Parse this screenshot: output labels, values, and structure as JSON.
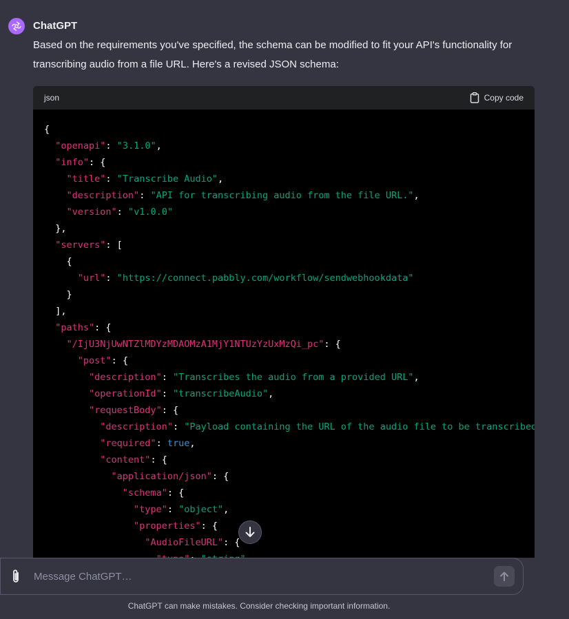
{
  "author": "ChatGPT",
  "message": "Based on the requirements you've specified, the schema can be modified to fit your API's functionality for transcribing audio from a file URL. Here's a revised JSON schema:",
  "code_block": {
    "language": "json",
    "copy_label": "Copy code",
    "lines": [
      [
        [
          "p",
          "{"
        ]
      ],
      [
        [
          "p",
          "  "
        ],
        [
          "k",
          "\"openapi\""
        ],
        [
          "p",
          ": "
        ],
        [
          "s",
          "\"3.1.0\""
        ],
        [
          "p",
          ","
        ]
      ],
      [
        [
          "p",
          "  "
        ],
        [
          "k",
          "\"info\""
        ],
        [
          "p",
          ": {"
        ]
      ],
      [
        [
          "p",
          "    "
        ],
        [
          "k",
          "\"title\""
        ],
        [
          "p",
          ": "
        ],
        [
          "s",
          "\"Transcribe Audio\""
        ],
        [
          "p",
          ","
        ]
      ],
      [
        [
          "p",
          "    "
        ],
        [
          "k",
          "\"description\""
        ],
        [
          "p",
          ": "
        ],
        [
          "s",
          "\"API for transcribing audio from the file URL.\""
        ],
        [
          "p",
          ","
        ]
      ],
      [
        [
          "p",
          "    "
        ],
        [
          "k",
          "\"version\""
        ],
        [
          "p",
          ": "
        ],
        [
          "s",
          "\"v1.0.0\""
        ]
      ],
      [
        [
          "p",
          "  },"
        ]
      ],
      [
        [
          "p",
          "  "
        ],
        [
          "k",
          "\"servers\""
        ],
        [
          "p",
          ": ["
        ]
      ],
      [
        [
          "p",
          "    {"
        ]
      ],
      [
        [
          "p",
          "      "
        ],
        [
          "k",
          "\"url\""
        ],
        [
          "p",
          ": "
        ],
        [
          "s",
          "\"https://connect.pabbly.com/workflow/sendwebhookdata\""
        ]
      ],
      [
        [
          "p",
          "    }"
        ]
      ],
      [
        [
          "p",
          "  ],"
        ]
      ],
      [
        [
          "p",
          "  "
        ],
        [
          "k",
          "\"paths\""
        ],
        [
          "p",
          ": {"
        ]
      ],
      [
        [
          "p",
          "    "
        ],
        [
          "k",
          "\"/IjU3NjUwNTZlMDYzMDAOMzA1MjY1NTUzYzUxMzQi_pc\""
        ],
        [
          "p",
          ": {"
        ]
      ],
      [
        [
          "p",
          "      "
        ],
        [
          "k",
          "\"post\""
        ],
        [
          "p",
          ": {"
        ]
      ],
      [
        [
          "p",
          "        "
        ],
        [
          "k",
          "\"description\""
        ],
        [
          "p",
          ": "
        ],
        [
          "s",
          "\"Transcribes the audio from a provided URL\""
        ],
        [
          "p",
          ","
        ]
      ],
      [
        [
          "p",
          "        "
        ],
        [
          "k",
          "\"operationId\""
        ],
        [
          "p",
          ": "
        ],
        [
          "s",
          "\"transcribeAudio\""
        ],
        [
          "p",
          ","
        ]
      ],
      [
        [
          "p",
          "        "
        ],
        [
          "k",
          "\"requestBody\""
        ],
        [
          "p",
          ": {"
        ]
      ],
      [
        [
          "p",
          "          "
        ],
        [
          "k",
          "\"description\""
        ],
        [
          "p",
          ": "
        ],
        [
          "s",
          "\"Payload containing the URL of the audio file to be transcribed\""
        ],
        [
          "p",
          ","
        ]
      ],
      [
        [
          "p",
          "          "
        ],
        [
          "k",
          "\"required\""
        ],
        [
          "p",
          ": "
        ],
        [
          "b",
          "true"
        ],
        [
          "p",
          ","
        ]
      ],
      [
        [
          "p",
          "          "
        ],
        [
          "k",
          "\"content\""
        ],
        [
          "p",
          ": {"
        ]
      ],
      [
        [
          "p",
          "            "
        ],
        [
          "k",
          "\"application/json\""
        ],
        [
          "p",
          ": {"
        ]
      ],
      [
        [
          "p",
          "              "
        ],
        [
          "k",
          "\"schema\""
        ],
        [
          "p",
          ": {"
        ]
      ],
      [
        [
          "p",
          "                "
        ],
        [
          "k",
          "\"type\""
        ],
        [
          "p",
          ": "
        ],
        [
          "s",
          "\"object\""
        ],
        [
          "p",
          ","
        ]
      ],
      [
        [
          "p",
          "                "
        ],
        [
          "k",
          "\"properties\""
        ],
        [
          "p",
          ": {"
        ]
      ],
      [
        [
          "p",
          "                  "
        ],
        [
          "k",
          "\"AudioFileURL\""
        ],
        [
          "p",
          ": {"
        ]
      ],
      [
        [
          "p",
          "                    "
        ],
        [
          "k",
          "\"type\""
        ],
        [
          "p",
          ": "
        ],
        [
          "s",
          "\"string\""
        ],
        [
          "p",
          ","
        ]
      ]
    ]
  },
  "composer": {
    "placeholder": "Message ChatGPT…"
  },
  "disclaimer": "ChatGPT can make mistakes. Consider checking important information.",
  "colors": {
    "background": "#343541",
    "code_bg": "#000000",
    "code_header": "#202123",
    "key": "#df3079",
    "string": "#00a67d",
    "boolean": "#2e95d3",
    "avatar": "#ab68ff"
  },
  "icons": [
    "openai-logo-icon",
    "clipboard-icon",
    "arrow-down-icon",
    "paperclip-icon",
    "arrow-up-icon"
  ]
}
